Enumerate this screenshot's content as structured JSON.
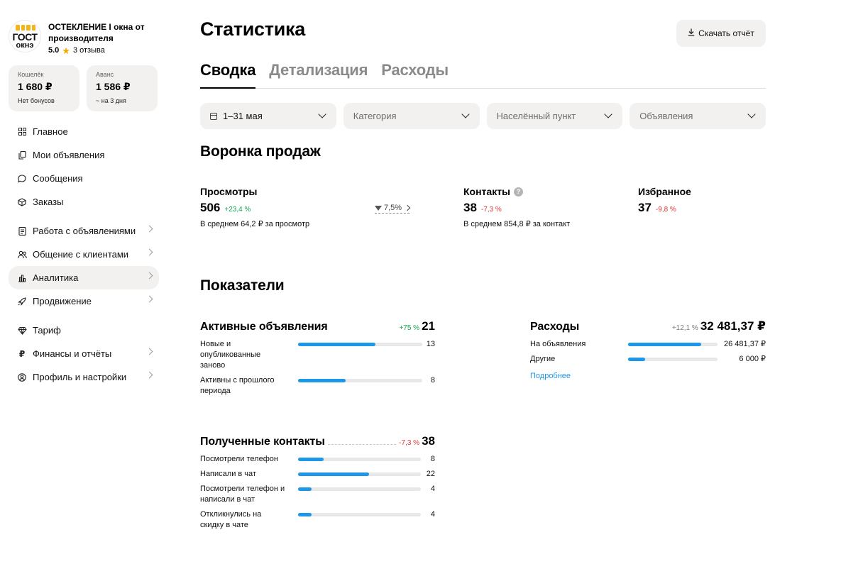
{
  "company": {
    "logo_top": "ГОСТ",
    "logo_bottom": "окнэ",
    "name": "ОСТЕКЛЕНИЕ I окна от производителя",
    "rating": "5.0",
    "reviews": "3 отзыва"
  },
  "wallets": [
    {
      "label": "Кошелёк",
      "value": "1 680 ₽",
      "note": "Нет бонусов"
    },
    {
      "label": "Аванс",
      "value": "1 586 ₽",
      "note": "~ на 3 дня"
    }
  ],
  "menu": [
    {
      "label": "Главное",
      "icon": "grid-icon",
      "chevron": false
    },
    {
      "label": "Мои объявления",
      "icon": "copy-icon",
      "chevron": false
    },
    {
      "label": "Сообщения",
      "icon": "chat-bubble-icon",
      "chevron": false
    },
    {
      "label": "Заказы",
      "icon": "box-icon",
      "chevron": false
    },
    {
      "label": "Работа с объявлениями",
      "icon": "document-icon",
      "chevron": true
    },
    {
      "label": "Общение с клиентами",
      "icon": "people-icon",
      "chevron": true
    },
    {
      "label": "Аналитика",
      "icon": "bar-chart-icon",
      "chevron": true,
      "active": true
    },
    {
      "label": "Продвижение",
      "icon": "rocket-icon",
      "chevron": true
    },
    {
      "label": "Тариф",
      "icon": "diamond-icon",
      "chevron": false
    },
    {
      "label": "Финансы и отчёты",
      "icon": "ruble-icon",
      "chevron": true
    },
    {
      "label": "Профиль и настройки",
      "icon": "user-circle-icon",
      "chevron": true
    }
  ],
  "page": {
    "title": "Статистика",
    "download": "Скачать отчёт"
  },
  "tabs": [
    {
      "label": "Сводка",
      "active": true
    },
    {
      "label": "Детализация",
      "active": false
    },
    {
      "label": "Расходы",
      "active": false
    }
  ],
  "filters": {
    "date": "1–31 мая",
    "category": "Категория",
    "location": "Населённый пункт",
    "ads": "Объявления"
  },
  "funnel": {
    "title": "Воронка продаж",
    "views": {
      "label": "Просмотры",
      "value": "506",
      "delta": "+23,4 %",
      "avg": "В среднем 64,2 ₽ за просмотр"
    },
    "conversion": "7,5%",
    "contacts": {
      "label": "Контакты",
      "value": "38",
      "delta": "-7,3 %",
      "avg": "В среднем 854,8 ₽ за контакт"
    },
    "favorites": {
      "label": "Избранное",
      "value": "37",
      "delta": "-9,8 %"
    }
  },
  "indicators": {
    "title": "Показатели",
    "active_ads": {
      "title": "Активные объявления",
      "delta": "+75 %",
      "total": "21",
      "rows": [
        {
          "label": "Новые и опубликованные заново",
          "value": "13",
          "share": 0.62
        },
        {
          "label": "Активны с прошлого периода",
          "value": "8",
          "share": 0.38
        }
      ]
    },
    "expenses": {
      "title": "Расходы",
      "delta": "+12,1 %",
      "total": "32 481,37 ₽",
      "rows": [
        {
          "label": "На объявления",
          "value": "26 481,37 ₽",
          "share": 0.82
        },
        {
          "label": "Другие",
          "value": "6 000 ₽",
          "share": 0.19
        }
      ],
      "link": "Подробнее"
    },
    "contacts": {
      "title": "Полученные контакты",
      "delta": "-7,3 %",
      "total": "38",
      "rows": [
        {
          "label": "Посмотрели телефон",
          "value": "8",
          "share": 0.21
        },
        {
          "label": "Написали в чат",
          "value": "22",
          "share": 0.58
        },
        {
          "label": "Посмотрели телефон и написали в чат",
          "value": "4",
          "share": 0.11
        },
        {
          "label": "Откликнулись на скидку в чате",
          "value": "4",
          "share": 0.11
        }
      ]
    }
  }
}
